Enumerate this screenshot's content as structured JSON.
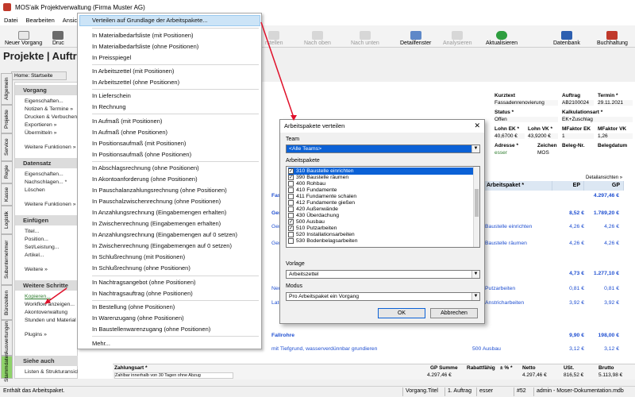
{
  "window": {
    "title": "MOS'aik Projektverwaltung (Firma Muster AG)"
  },
  "menubar": [
    "Datei",
    "Bearbeiten",
    "Ansich"
  ],
  "toolbar": {
    "neuer_vorgang": "Neuer Vorgang",
    "druck": "Druc",
    "erstellen": "rstellen",
    "nach_oben": "Nach oben",
    "nach_unten": "Nach unten",
    "detailfenster": "Detailfenster",
    "analysieren": "Analysieren",
    "aktualisieren": "Aktualisieren",
    "datenbank": "Datenbank",
    "buchhaltung": "Buchhaltung"
  },
  "page_title": "Projekte | Aufträg",
  "breadcrumb": "Home: Startseite",
  "vtabs": [
    "Allgemein",
    "Projekte",
    "Service",
    "Regie",
    "Kasse",
    "Logistik",
    "Subunternehmer",
    "Bürozeiten",
    "Auswertungen",
    "Stammdaten"
  ],
  "sidebar": {
    "vorgang": {
      "title": "Vorgang",
      "items": [
        "Eigenschaften...",
        "Notizen & Termine »",
        "Drucken & Verbuchen",
        "Exportieren »",
        "Übermitteln »",
        "Weitere Funktionen »"
      ]
    },
    "datensatz": {
      "title": "Datensatz",
      "items": [
        "Eigenschaften...",
        "Nachschlagen... *",
        "Löschen",
        "Weitere Funktionen »"
      ]
    },
    "einfuegen": {
      "title": "Einfügen",
      "items": [
        "Titel...",
        "Position...",
        "Set/Leistung...",
        "Artikel...",
        "Weitere »"
      ]
    },
    "weitere": {
      "title": "Weitere Schritte",
      "items": [
        "Kopieren...",
        "Workflow anzeigen...",
        "Akontoverwaltung",
        "Stunden und Material",
        "Plugins »"
      ]
    },
    "siehe": {
      "title": "Siehe auch",
      "items": [
        "Listen & Strukturansichten »"
      ]
    }
  },
  "info": {
    "kurztext_h": "Kurztext",
    "kurztext": "Fassadenrenovierung",
    "auftrag_h": "Auftrag",
    "auftrag": "AB2100024",
    "termin_h": "Termin *",
    "termin": "29.11.2021",
    "status_h": "Status *",
    "status": "Offen",
    "kalk_h": "Kalkulationsart *",
    "kalk": "EK+Zuschlag",
    "lohn_ek_h": "Lohn EK *",
    "lohn_ek": "40,6700 €",
    "lohn_vk_h": "Lohn VK *",
    "lohn_vk": "43,9200 €",
    "mf_ek_h": "MFaktor EK",
    "mf_ek": "1",
    "mf_vk_h": "MFaktor VK",
    "mf_vk": "1,26",
    "adresse_h": "Adresse *",
    "adresse": "esser",
    "zeichen_h": "Zeichen",
    "zeichen": "MOS",
    "beleg_h": "Beleg-Nr.",
    "belegdatum_h": "Belegdatum",
    "detailansichten": "Detailansichten »"
  },
  "grid": {
    "headers": {
      "arbeitspaket": "Arbeitspaket *",
      "ep": "EP",
      "gp": "GP"
    },
    "rows": [
      {
        "left": "Fas",
        "pkg": "",
        "ep": "",
        "gp": "4.297,46 €"
      },
      {
        "left": "Ger",
        "pkg": "",
        "ep": "8,52 €",
        "gp": "1.789,20 €"
      },
      {
        "left": "Ger",
        "pkg": "Baustelle einrichten",
        "ep": "4,26 €",
        "gp": "4,26 €"
      },
      {
        "left": "Ger",
        "pkg": "Baustelle räumen",
        "ep": "4,26 €",
        "gp": "4,26 €"
      },
      {
        "left": "",
        "pkg": "",
        "ep": "4,73 €",
        "gp": "1.277,10 €"
      },
      {
        "left": "Ner",
        "pkg": "Putzarbeiten",
        "ep": "0,81 €",
        "gp": "0,81 €"
      },
      {
        "left": "Late",
        "pkg": "Anstricharbeiten",
        "ep": "3,92 €",
        "gp": "3,92 €"
      },
      {
        "left": "Fallrohre",
        "pkg": "",
        "ep": "9,90 €",
        "gp": "198,00 €"
      },
      {
        "left": "mit Tiefgrund, wasserverdünnbar grundieren",
        "pkg": "500 Ausbau",
        "ep": "3,12 €",
        "gp": "3,12 €"
      }
    ]
  },
  "footer": {
    "zahlungsart_h": "Zahlungsart *",
    "zahlungsart": "Zahlbar innerhalb von 30 Tagen ohne Abzug",
    "gp_summe_h": "GP Summe",
    "gp_summe": "4.297,46 €",
    "rabatt_h": "Rabattfähig",
    "prozent_h": "± % *",
    "netto_h": "Netto",
    "netto": "4.297,46 €",
    "ust_h": "USt.",
    "ust": "816,52 €",
    "brutto_h": "Brutto",
    "brutto": "5.113,98 €"
  },
  "statusbar": {
    "left": "Enthält das Arbeitspaket.",
    "vorgang": "Vorgang.Titel",
    "auftrag": "1. Auftrag",
    "user": "esser",
    "num": "#52",
    "db": "admin - Moser-Dokumentation.mdb"
  },
  "popup_menu": [
    "Verteilen auf Grundlage der Arbeitspakete...",
    "In Materialbedarfsliste (mit Positionen)",
    "In Materialbedarfsliste (ohne Positionen)",
    "In Preisspiegel",
    "In Arbeitszettel (mit Positionen)",
    "In Arbeitszettel (ohne Positionen)",
    "In Lieferschein",
    "In Rechnung",
    "In Aufmaß (mit Positionen)",
    "In Aufmaß (ohne Positionen)",
    "In Positionsaufmaß (mit Positionen)",
    "In Positionsaufmaß (ohne Positionen)",
    "In Abschlagsrechnung (ohne Positionen)",
    "In Akontoanforderung (ohne Positionen)",
    "In Pauschalanzahlungsrechnung (ohne Positionen)",
    "In Pauschalzwischenrechnung (ohne Positionen)",
    "In Anzahlungsrechnung (Eingabemengen erhalten)",
    "In Zwischenrechnung (Eingabemengen erhalten)",
    "In Anzahlungsrechnung (Eingabemengen auf 0 setzen)",
    "In Zwischenrechnung (Eingabemengen auf 0 setzen)",
    "In Schlußrechnung (mit Positionen)",
    "In Schlußrechnung (ohne Positionen)",
    "In Nachtragsangebot (ohne Positionen)",
    "In Nachtragsauftrag (ohne Positionen)",
    "In Bestellung (ohne Positionen)",
    "In Warenzugang (ohne Positionen)",
    "In Baustellenwarenzugang (ohne Positionen)",
    "Mehr..."
  ],
  "dialog": {
    "title": "Arbeitspakete verteilen",
    "team_label": "Team",
    "team_value": "<Alle Teams>",
    "packages_label": "Arbeitspakete",
    "packages": [
      {
        "label": "310 Baustelle einrichten",
        "checked": true,
        "selected": true
      },
      {
        "label": "390 Baustelle räumen",
        "checked": true,
        "selected": false
      },
      {
        "label": "400 Rohbau",
        "checked": false,
        "selected": false
      },
      {
        "label": "410 Fundamente",
        "checked": false,
        "selected": false
      },
      {
        "label": "411 Fundamente schalen",
        "checked": false,
        "selected": false
      },
      {
        "label": "412 Fundamente gießen",
        "checked": false,
        "selected": false
      },
      {
        "label": "420 Außenwände",
        "checked": false,
        "selected": false
      },
      {
        "label": "430 Überdachung",
        "checked": false,
        "selected": false
      },
      {
        "label": "500 Ausbau",
        "checked": true,
        "selected": false
      },
      {
        "label": "510 Putzarbeiten",
        "checked": true,
        "selected": false
      },
      {
        "label": "520 Installationsarbeiten",
        "checked": false,
        "selected": false
      },
      {
        "label": "530 Bodenbelagsarbeiten",
        "checked": false,
        "selected": false
      }
    ],
    "vorlage_label": "Vorlage",
    "vorlage_value": "Arbeitszettel",
    "modus_label": "Modus",
    "modus_value": "Pro Arbeitspaket ein Vorgang",
    "ok": "OK",
    "cancel": "Abbrechen"
  },
  "colors": {
    "highlight": "#cce4f7",
    "selection": "#0b61d6",
    "link_blue": "#1f4fd1",
    "active_tab": "#8fd36a",
    "annotation": "#e0102a"
  }
}
